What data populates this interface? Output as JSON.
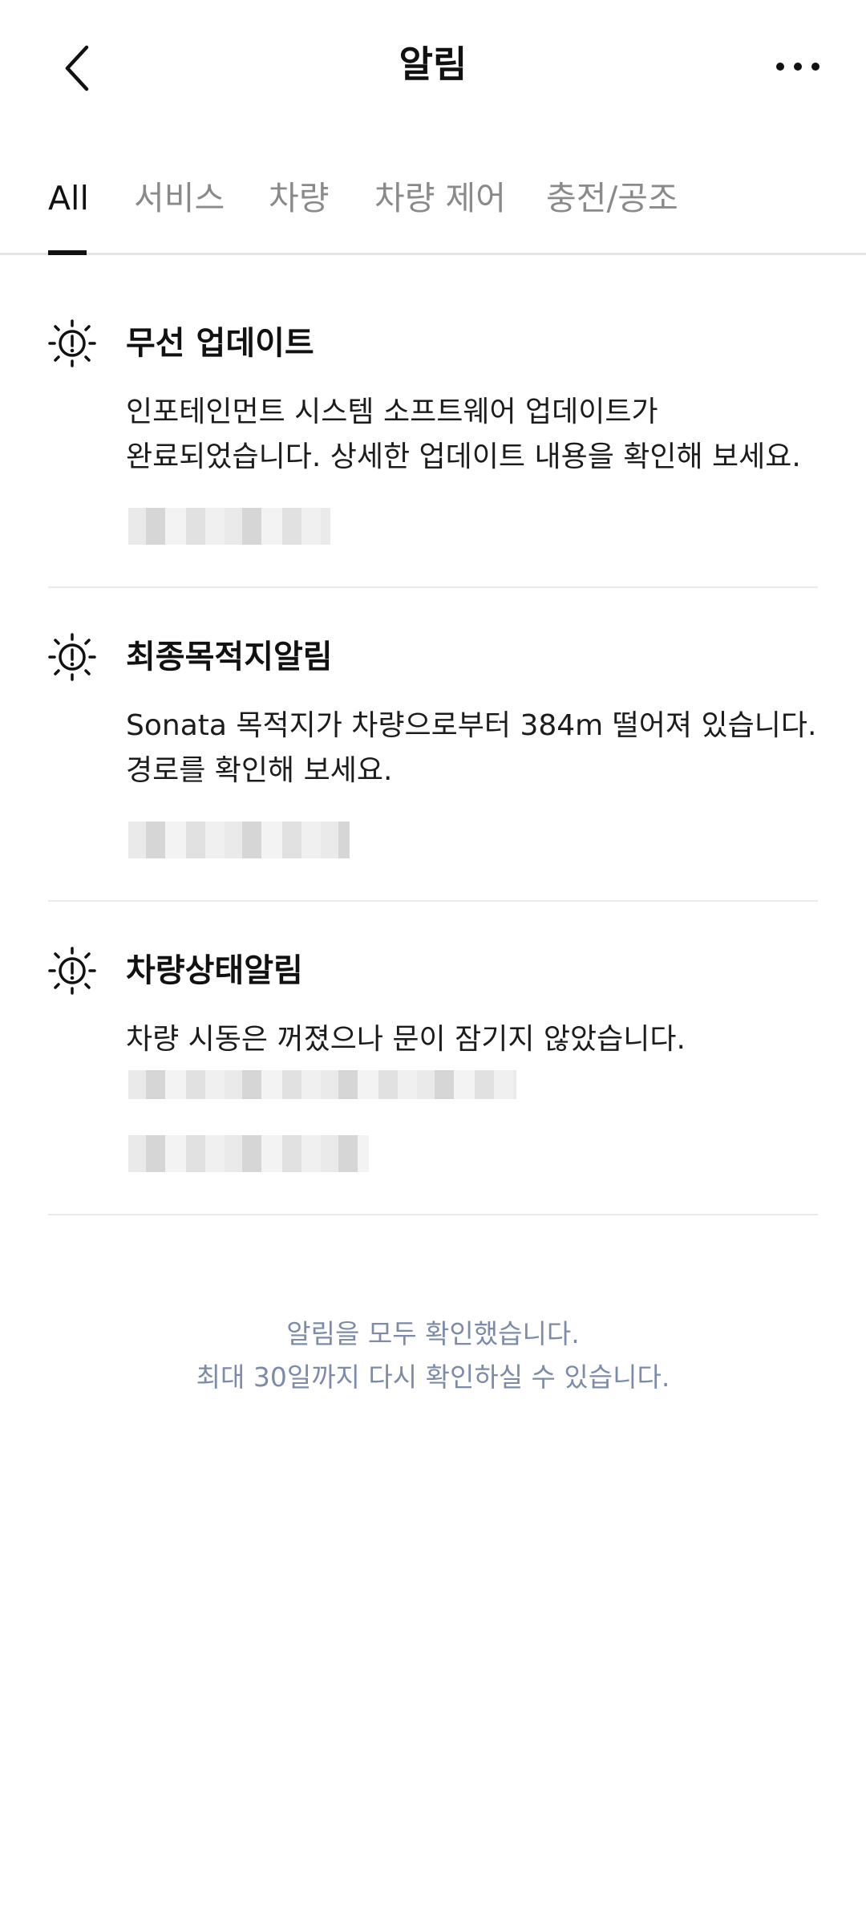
{
  "header": {
    "title": "알림",
    "back_icon": "chevron-left-icon",
    "more_icon": "more-horizontal-icon"
  },
  "tabs": [
    {
      "label": "All",
      "active": true
    },
    {
      "label": "서비스",
      "active": false
    },
    {
      "label": "차량",
      "active": false
    },
    {
      "label": "차량 제어",
      "active": false
    },
    {
      "label": "충전/공조",
      "active": false
    }
  ],
  "notifications": [
    {
      "icon": "alert-lightbulb-icon",
      "title": "무선 업데이트",
      "body_lines": [
        "인포테인먼트 시스템 소프트웨어 업데이트가",
        "완료되었습니다. 상세한 업데이트 내용을 확인해 보세요."
      ]
    },
    {
      "icon": "alert-lightbulb-icon",
      "title": "최종목적지알림",
      "body_lines": [
        "Sonata 목적지가 차량으로부터 384m 떨어져 있습니다.",
        "경로를 확인해 보세요."
      ]
    },
    {
      "icon": "alert-lightbulb-icon",
      "title": "차량상태알림",
      "body_lines": [
        "차량 시동은 꺼졌으나 문이 잠기지 않았습니다."
      ]
    }
  ],
  "footer": {
    "line1": "알림을 모두 확인했습니다.",
    "line2": "최대 30일까지 다시 확인하실 수 있습니다."
  },
  "colors": {
    "text_primary": "#111111",
    "tab_inactive": "#8a8a8a",
    "divider": "#ebebeb",
    "footer_text": "#7d8ba8"
  }
}
